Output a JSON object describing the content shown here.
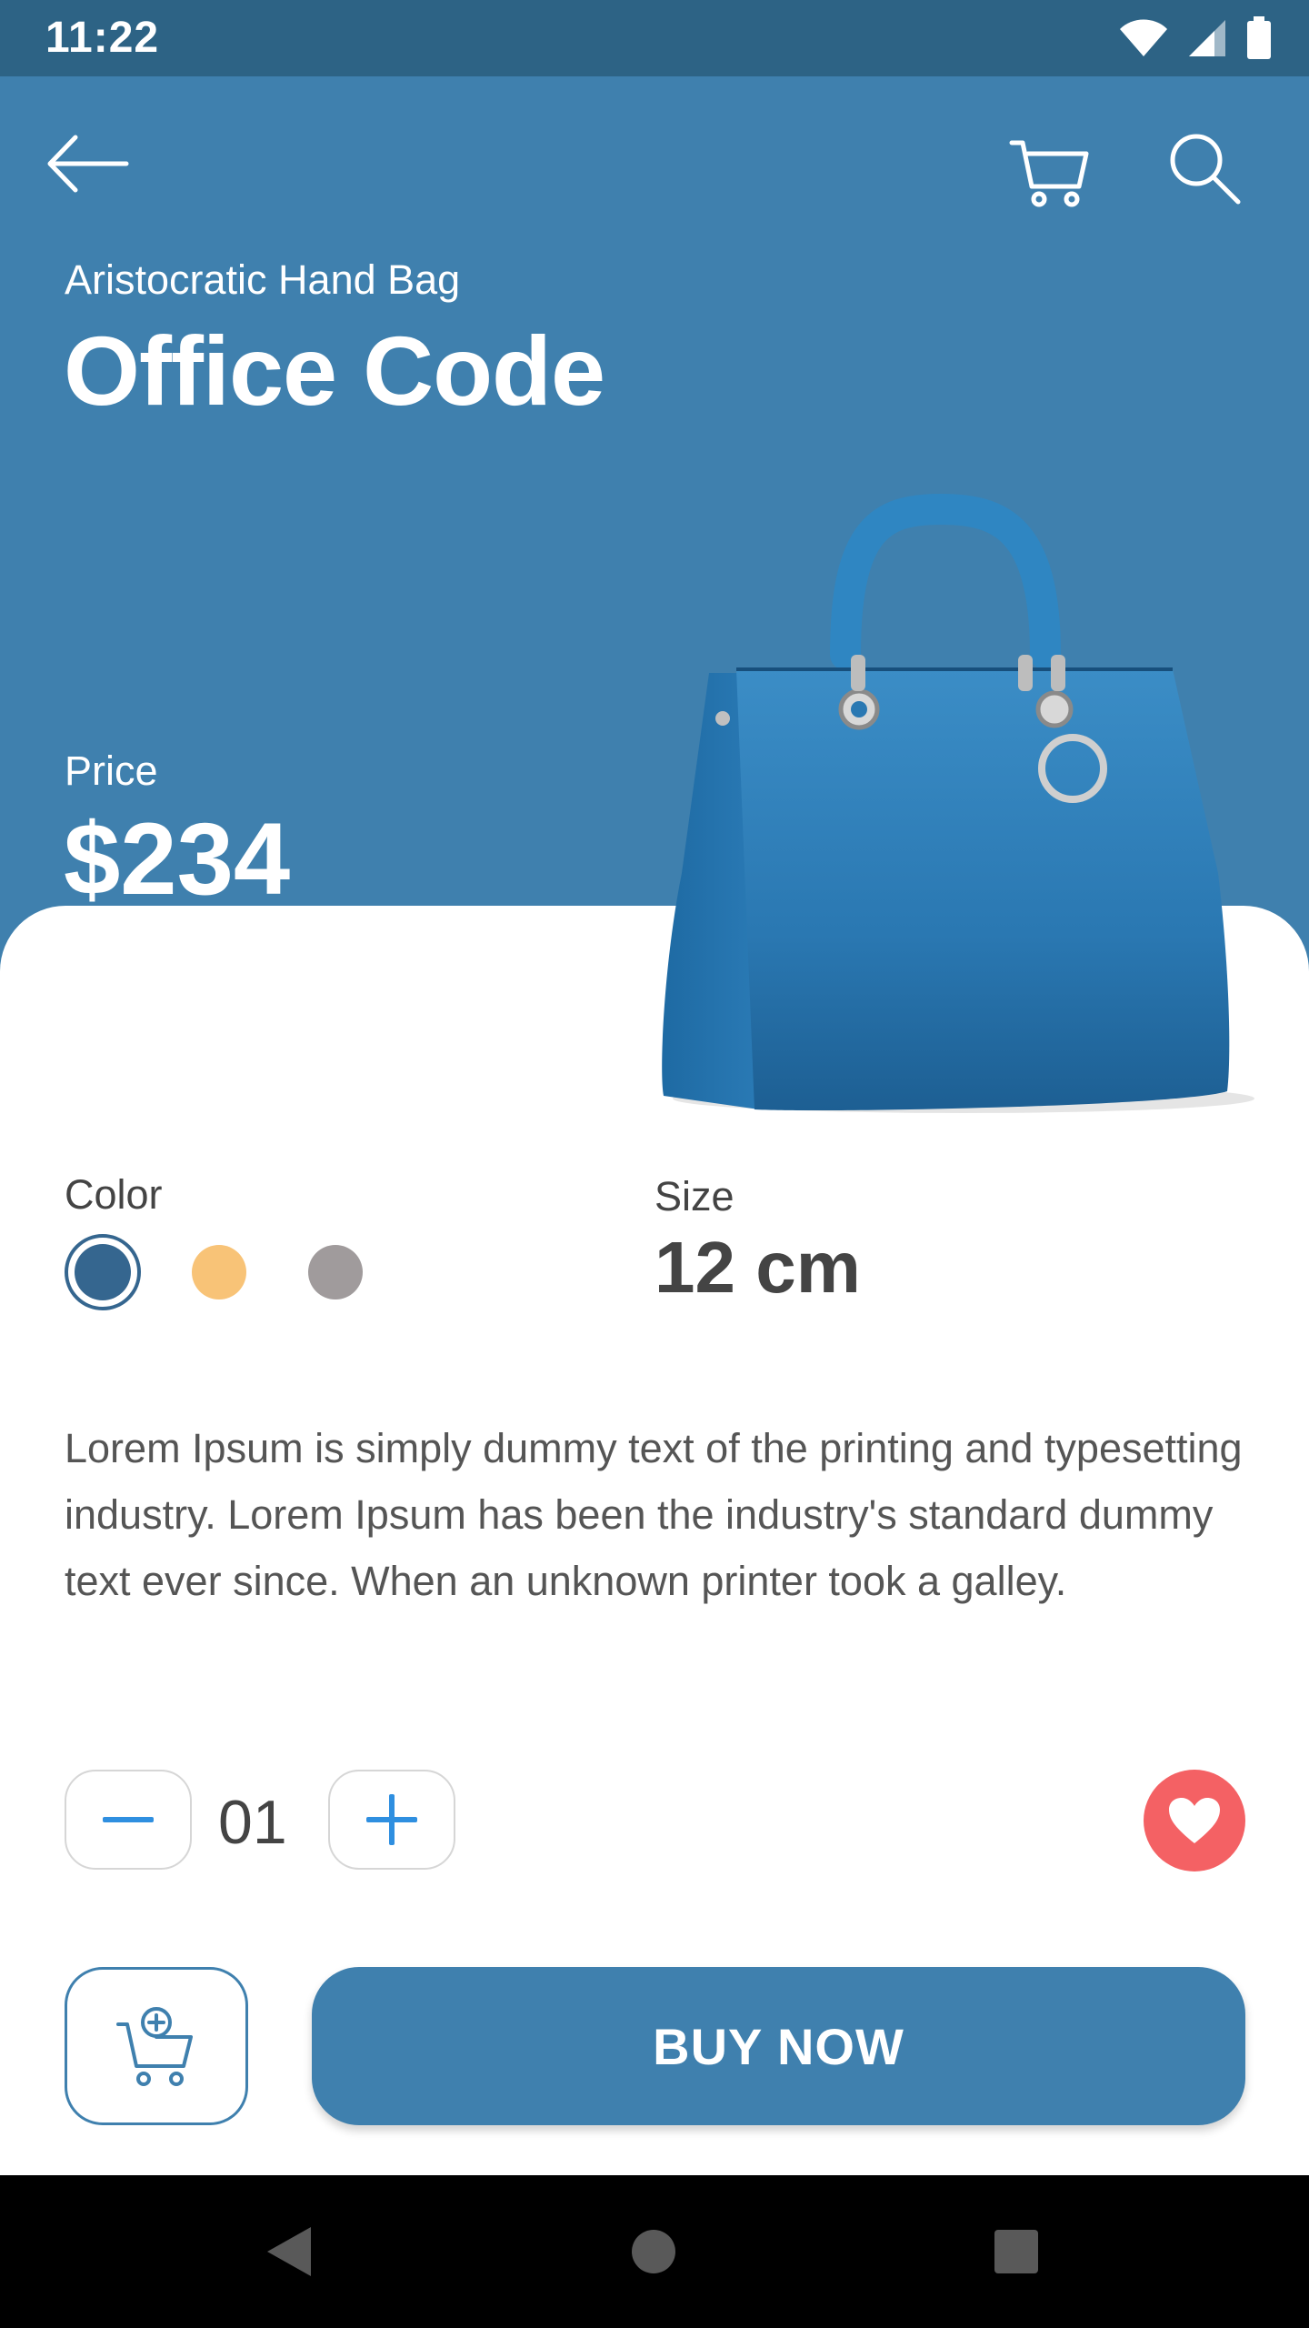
{
  "status_bar": {
    "time": "11:22"
  },
  "product": {
    "subtitle": "Aristocratic Hand Bag",
    "title": "Office Code",
    "price_label": "Price",
    "price": "$234"
  },
  "options": {
    "color_label": "Color",
    "colors": [
      "#35668f",
      "#f8c377",
      "#a09b9c"
    ],
    "selected_color_index": 0,
    "size_label": "Size",
    "size_value": "12 cm"
  },
  "description": "Lorem Ipsum is simply dummy text of the printing and typesetting industry. Lorem Ipsum has been the industry's standard dummy text ever since. When an unknown printer took a galley.",
  "quantity": {
    "value": "01"
  },
  "actions": {
    "buy_label": "BUY NOW"
  },
  "theme": {
    "primary": "#3f80ae",
    "favorite": "#f46164"
  },
  "icons": [
    "back-arrow-icon",
    "cart-icon",
    "search-icon",
    "minus-icon",
    "plus-icon",
    "heart-icon",
    "add-to-cart-icon"
  ]
}
